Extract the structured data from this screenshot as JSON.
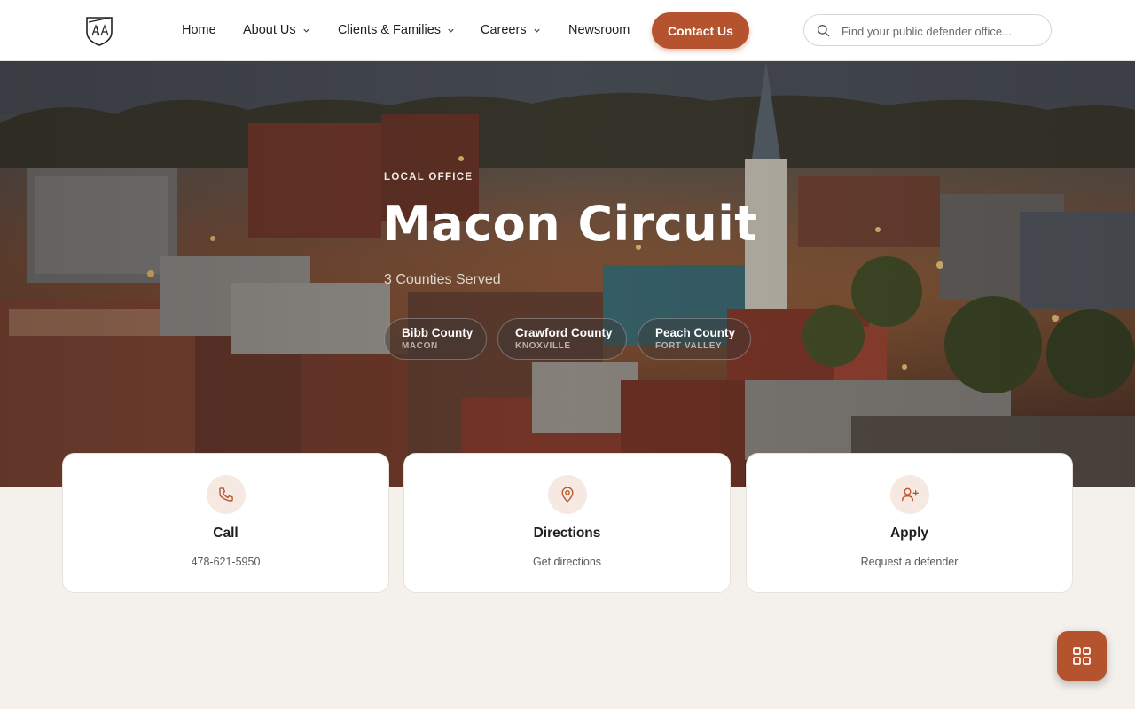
{
  "header": {
    "nav": {
      "home": "Home",
      "about": "About Us",
      "clients": "Clients & Families",
      "careers": "Careers",
      "newsroom": "Newsroom"
    },
    "contact_label": "Contact Us",
    "search_placeholder": "Find your public defender office..."
  },
  "hero": {
    "eyebrow": "LOCAL OFFICE",
    "title": "Macon Circuit",
    "subtitle": "3 Counties Served",
    "counties": [
      {
        "name": "Bibb County",
        "town": "MACON"
      },
      {
        "name": "Crawford County",
        "town": "KNOXVILLE"
      },
      {
        "name": "Peach County",
        "town": "FORT VALLEY"
      }
    ]
  },
  "cards": [
    {
      "title": "Call",
      "subtitle": "478-621-5950",
      "icon": "phone-icon"
    },
    {
      "title": "Directions",
      "subtitle": "Get directions",
      "icon": "map-pin-icon"
    },
    {
      "title": "Apply",
      "subtitle": "Request a defender",
      "icon": "user-plus-icon"
    }
  ],
  "colors": {
    "accent": "#b5532f",
    "icon_bg": "#f6e9e2",
    "page_bg": "#f4f1ec"
  },
  "fab_icon": "grid-icon"
}
